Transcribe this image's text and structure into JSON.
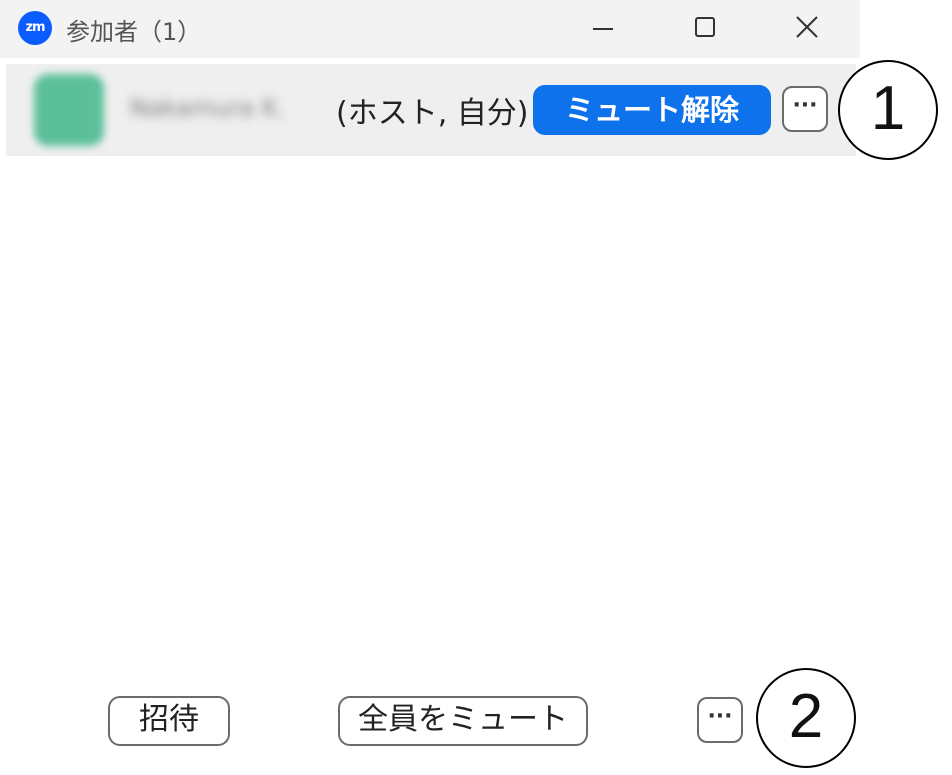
{
  "window": {
    "app_icon": "zoom-logo",
    "app_logo_text": "zm",
    "title": "参加者（1）",
    "controls": [
      "minimize-icon",
      "maximize-icon",
      "close-icon"
    ]
  },
  "participants": [
    {
      "name": "Nakamura K.",
      "role": "(ホスト, 自分)",
      "action_label": "ミュート解除",
      "more_label": "···",
      "avatar_color": "#5bbf9a"
    }
  ],
  "footer": {
    "invite_label": "招待",
    "mute_all_label": "全員をミュート",
    "more_label": "···"
  },
  "callouts": [
    "1",
    "2"
  ],
  "colors": {
    "accent": "#0e72ed",
    "brand": "#0b5cff",
    "titlebar_bg": "#f3f3f3",
    "row_bg": "#efefef"
  }
}
